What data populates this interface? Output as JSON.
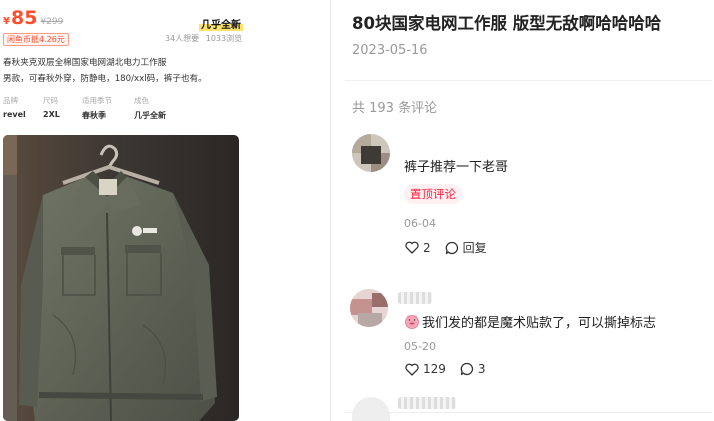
{
  "listing": {
    "currency": "¥",
    "price": "85",
    "original_price": "¥299",
    "condition": "几乎全新",
    "coin_deduct": "闲鱼币抵4.26元",
    "wants": "34人想要",
    "views": "1033浏览",
    "desc_line1": "春秋夹克双层全棉国家电网湖北电力工作服",
    "desc_line2": "男款，可春秋外穿，防静电，180/xxl码，裤子也有。",
    "attrs": [
      {
        "key": "品牌",
        "value": "revel"
      },
      {
        "key": "尺码",
        "value": "2XL"
      },
      {
        "key": "适用季节",
        "value": "春秋季"
      },
      {
        "key": "成色",
        "value": "几乎全新"
      }
    ],
    "photo_icon": "jacket-photo"
  },
  "post": {
    "title": "80块国家电网工作服 版型无敌啊哈哈哈哈",
    "date": "2023-05-16",
    "comment_count": "共 193 条评论"
  },
  "comments": [
    {
      "text": "裤子推荐一下老哥",
      "pinned_label": "置顶评论",
      "date": "06-04",
      "likes": "2",
      "reply_label": "回复"
    },
    {
      "emoji": "pig-emoji",
      "text": "我们发的都是魔术贴款了，可以撕掉标志",
      "date": "05-20",
      "likes": "129",
      "replies": "3"
    }
  ],
  "colors": {
    "price_red": "#ff4d2d",
    "pinned_red": "#ff2442",
    "muted": "#999999"
  }
}
